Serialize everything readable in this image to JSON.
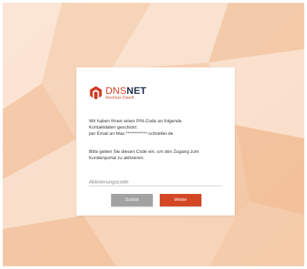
{
  "brand": {
    "name_part1": "DNS",
    "name_part2": "NET",
    "tagline": "Anschluss Zukunft."
  },
  "message": {
    "line1": "Wir haben Ihnen einen PIN-Code an folgende",
    "line2": "Kontaktdaten geschickt:",
    "line3": "per Email an Max.************-schneller.de",
    "line4": "Bitte geben Sie diesen Code ein, um den Zugang zum",
    "line5": "Kundenportal zu aktivieren."
  },
  "form": {
    "code_placeholder": "Aktivierungscode",
    "code_value": ""
  },
  "buttons": {
    "back_label": "Zurück",
    "next_label": "Weiter"
  },
  "colors": {
    "brand_red": "#cf3b22",
    "brand_navy": "#1d2b4f",
    "back_button": "#a2a2a2",
    "next_button": "#d44724",
    "background": "#f6d7bf"
  },
  "icons": {
    "logo": "dnsnet-logo-icon"
  }
}
